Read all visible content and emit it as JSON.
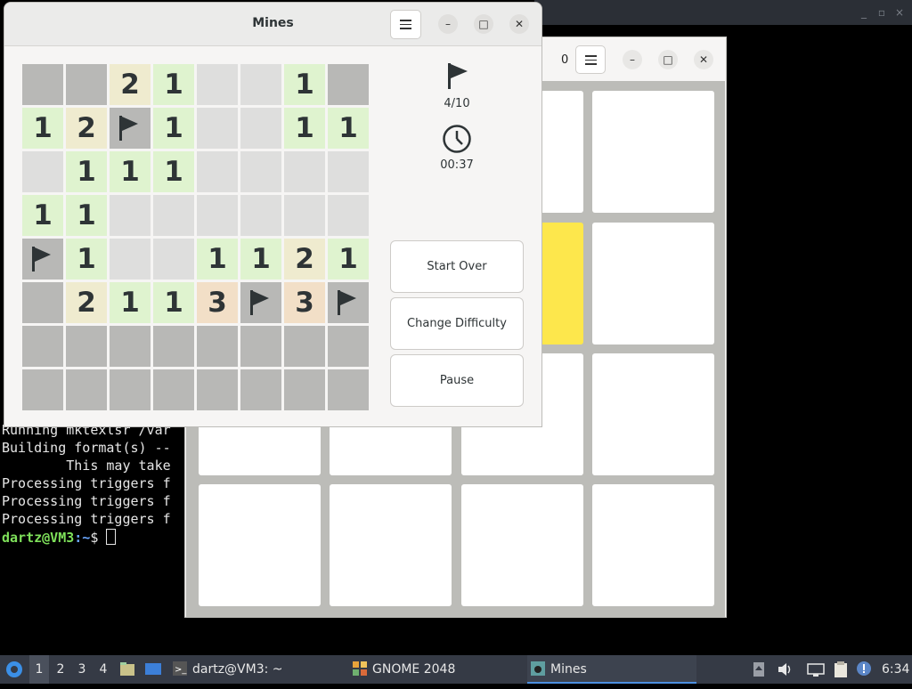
{
  "mines": {
    "title": "Mines",
    "flags_text": "4/10",
    "time_text": "00:37",
    "buttons": {
      "start_over": "Start Over",
      "change_difficulty": "Change Difficulty",
      "pause": "Pause"
    },
    "grid": [
      [
        "H",
        "H",
        "2",
        "1",
        "E",
        "E",
        "1",
        "H"
      ],
      [
        "1",
        "2",
        "F",
        "1",
        "E",
        "E",
        "1",
        "1"
      ],
      [
        "E",
        "1",
        "1",
        "1",
        "E",
        "E",
        "E",
        "E"
      ],
      [
        "1",
        "1",
        "E",
        "E",
        "E",
        "E",
        "E",
        "E"
      ],
      [
        "F",
        "1",
        "E",
        "E",
        "1",
        "1",
        "2",
        "1"
      ],
      [
        "H",
        "2",
        "1",
        "1",
        "3",
        "F",
        "3",
        "F"
      ],
      [
        "H",
        "H",
        "H",
        "H",
        "H",
        "H",
        "H",
        "H"
      ],
      [
        "H",
        "H",
        "H",
        "H",
        "H",
        "H",
        "H",
        "H"
      ]
    ]
  },
  "game2048": {
    "score": "0"
  },
  "terminal": {
    "lines": [
      "Running mktexlsr /var",
      "Building format(s) --",
      "        This may take",
      "Processing triggers f",
      "Processing triggers f",
      "Processing triggers f"
    ],
    "prompt_user": "dartz@VM3",
    "prompt_path": ":~",
    "prompt_symbol": "$ "
  },
  "taskbar": {
    "workspaces": [
      "1",
      "2",
      "3",
      "4"
    ],
    "tasks": [
      {
        "label": "dartz@VM3: ~",
        "icon": "terminal-icon"
      },
      {
        "label": "GNOME 2048",
        "icon": "gnome-2048-icon"
      },
      {
        "label": "Mines",
        "icon": "mines-icon"
      }
    ],
    "clock": "6:34"
  },
  "colors": {
    "taskbar_bg": "#353a45",
    "accent_blue": "#4c8fe0",
    "prompt_green": "#7ee05a",
    "tile_yellow": "#fde74c"
  }
}
